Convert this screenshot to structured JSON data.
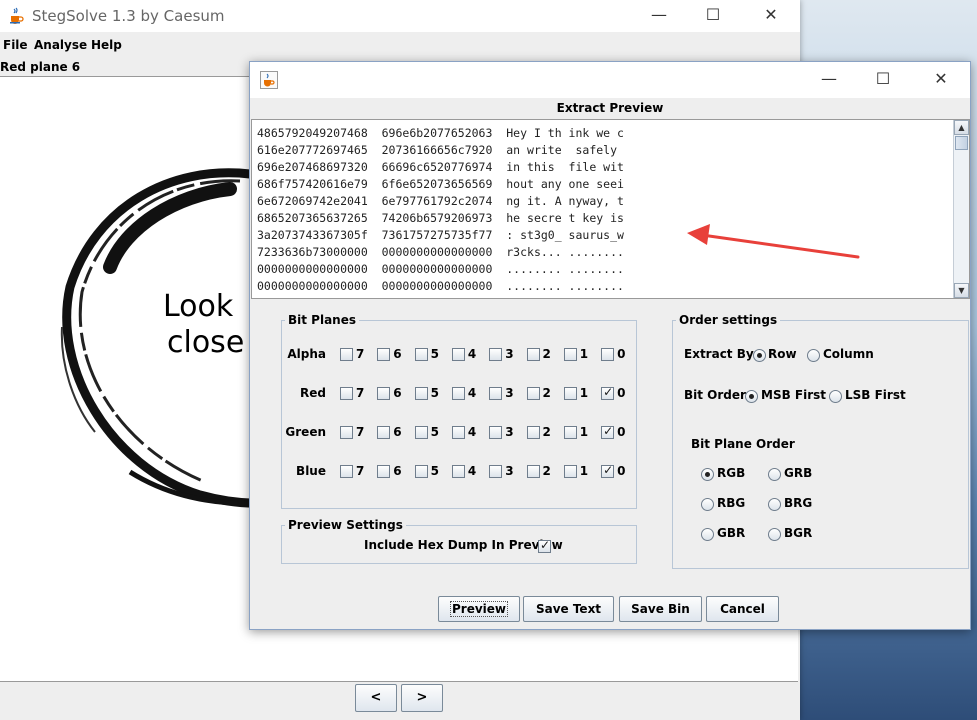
{
  "main_window": {
    "title": "StegSolve 1.3 by Caesum",
    "menu": [
      "File",
      "Analyse",
      "Help"
    ],
    "image_label": "Red plane 6",
    "image_text_line1": "Look",
    "image_text_line2": "close",
    "prev_button": "<",
    "next_button": ">"
  },
  "dialog": {
    "title": "",
    "header": "Extract Preview",
    "preview_lines": [
      "4865792049207468  696e6b2077652063  Hey I th ink we c",
      "616e207772697465  20736166656c7920  an write  safely",
      "696e207468697320  66696c6520776974  in this  file wit",
      "686f757420616e79  6f6e652073656569  hout any one seei",
      "6e672069742e2041  6e797761792c2074  ng it. A nyway, t",
      "6865207365637265  74206b6579206973  he secre t key is",
      "3a2073743367305f  7361757275735f77  : st3g0_ saurus_w",
      "7233636b73000000  0000000000000000  r3cks... ........",
      "0000000000000000  0000000000000000  ........ ........",
      "0000000000000000  0000000000000000  ........ ........"
    ],
    "bit_planes": {
      "legend": "Bit Planes",
      "bits": [
        "7",
        "6",
        "5",
        "4",
        "3",
        "2",
        "1",
        "0"
      ],
      "rows": [
        {
          "label": "Alpha",
          "checked": []
        },
        {
          "label": "Red",
          "checked": [
            "0"
          ]
        },
        {
          "label": "Green",
          "checked": [
            "0"
          ]
        },
        {
          "label": "Blue",
          "checked": [
            "0"
          ]
        }
      ]
    },
    "preview_settings": {
      "legend": "Preview Settings",
      "hex_dump_label": "Include Hex Dump In Preview",
      "hex_dump_checked": true
    },
    "order_settings": {
      "legend": "Order settings",
      "extract_by_label": "Extract By",
      "extract_by_options": [
        "Row",
        "Column"
      ],
      "extract_by_selected": "Row",
      "bit_order_label": "Bit Order",
      "bit_order_options": [
        "MSB First",
        "LSB First"
      ],
      "bit_order_selected": "MSB First",
      "plane_order_label": "Bit Plane Order",
      "plane_order_options": [
        "RGB",
        "GRB",
        "RBG",
        "BRG",
        "GBR",
        "BGR"
      ],
      "plane_order_selected": "RGB"
    },
    "buttons": {
      "preview": "Preview",
      "save_text": "Save Text",
      "save_bin": "Save Bin",
      "cancel": "Cancel"
    }
  },
  "colors": {
    "annotation_arrow": "#e8403a",
    "dialog_border": "#8aa2c4"
  }
}
